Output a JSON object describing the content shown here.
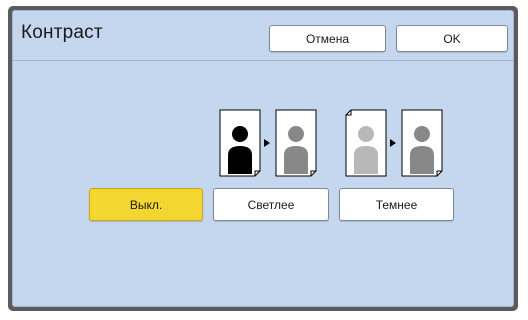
{
  "dialog": {
    "title": "Контраст",
    "cancel_label": "Отмена",
    "ok_label": "OK"
  },
  "options": {
    "off_label": "Выкл.",
    "lighter_label": "Светлее",
    "darker_label": "Темнее",
    "selected": "off"
  },
  "colors": {
    "panel_bg": "#c5d7ee",
    "selected_button": "#f4d630",
    "figure_black": "#000000",
    "figure_mid_gray": "#888888",
    "figure_light_gray": "#b8b8b8"
  },
  "icons": {
    "lighter": "contrast-lighter-icon",
    "darker": "contrast-darker-icon"
  }
}
